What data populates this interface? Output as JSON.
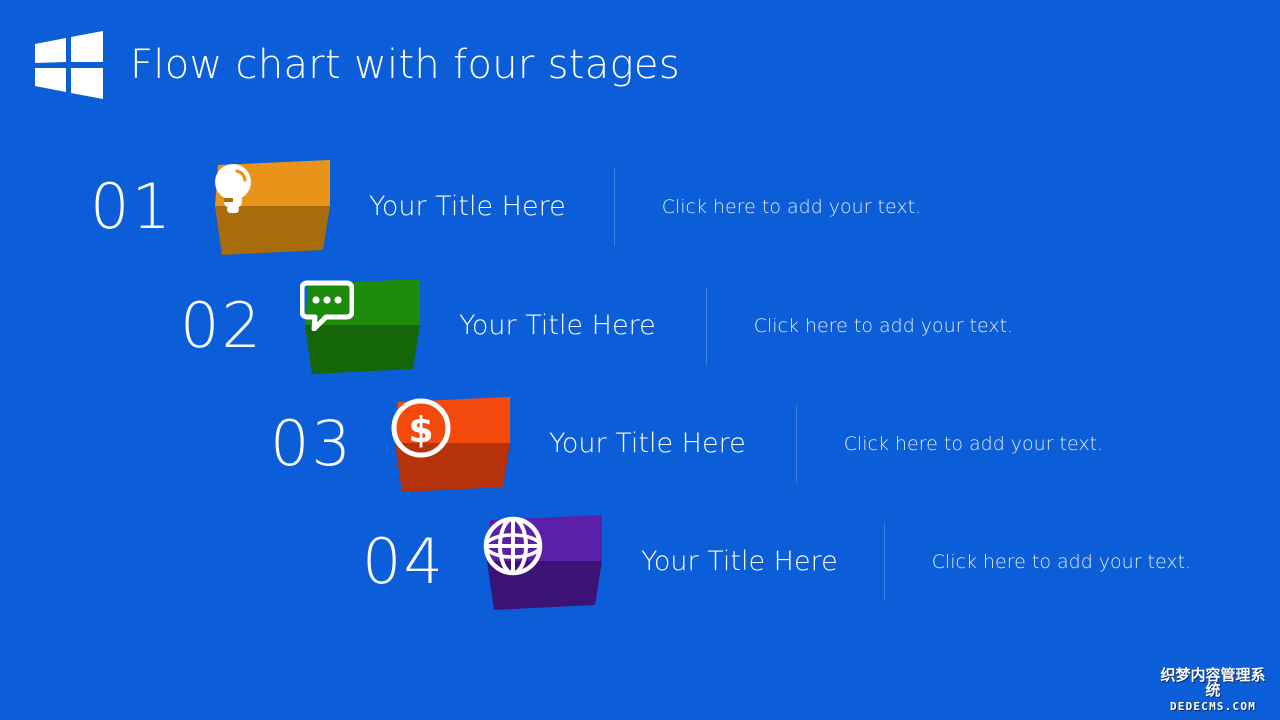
{
  "theme": {
    "background": "#0B5ED7",
    "title_color": "#FFFFFF",
    "divider_color": "#3E80E0",
    "body_text_color": "#E3ECFB"
  },
  "header": {
    "title": "Flow chart with four stages",
    "logo_icon": "windows-logo-icon"
  },
  "stages": [
    {
      "number": "01",
      "title": "Your Title Here",
      "body": "Click here to add your text.",
      "icon": "lightbulb-icon",
      "color_top": "#E8941A",
      "color_bottom": "#A96C0D"
    },
    {
      "number": "02",
      "title": "Your Title Here",
      "body": "Click here to add your text.",
      "icon": "speech-bubble-icon",
      "color_top": "#1E8A0C",
      "color_bottom": "#156608"
    },
    {
      "number": "03",
      "title": "Your Title Here",
      "body": "Click here to add your text.",
      "icon": "dollar-coin-icon",
      "color_top": "#F54A0E",
      "color_bottom": "#B5320A"
    },
    {
      "number": "04",
      "title": "Your Title Here",
      "body": "Click here to add your text.",
      "icon": "globe-icon",
      "color_top": "#5B1FA8",
      "color_bottom": "#3B1275"
    }
  ],
  "watermark": {
    "cn": "织梦内容管理系统",
    "en": "DEDECMS.COM"
  }
}
